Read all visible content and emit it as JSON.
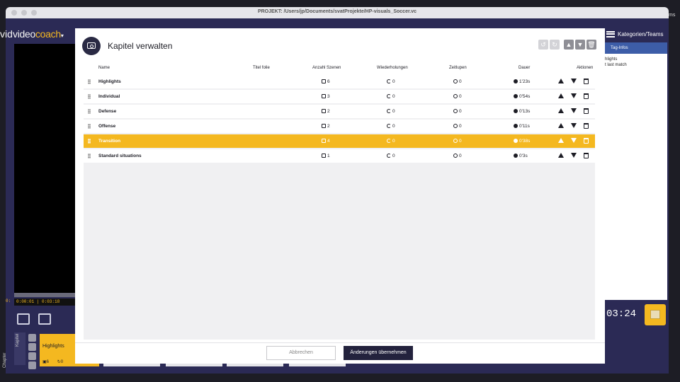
{
  "window": {
    "title": "PROJEKT: /Users/jp/Documents/svatProjekte/HP-visuals_Soccer.vc"
  },
  "app": {
    "logo_main": "video",
    "logo_accent": "coach",
    "logo_partial": "vid",
    "timecode": "0:00:01 | 0:03:18",
    "timecode_left": "0:",
    "big_time": "03:24",
    "top_edge_text": "ms",
    "sidebar_label": "Kapitel",
    "chapter_label": "Chapter",
    "chapter_card": {
      "title": "Highlights",
      "scenes": "6",
      "repeats": "0"
    },
    "right_header": "Kategorien/Teams",
    "tag_tab": "Tag-Infos",
    "tag_lines": [
      "hlights",
      "t last match"
    ]
  },
  "modal": {
    "title": "Kapitel verwalten",
    "columns": [
      "Name",
      "Titel folie",
      "Anzahl Szenen",
      "Wiederholungen",
      "Zeitlupen",
      "Dauer",
      "Aktionen"
    ],
    "rows": [
      {
        "name": "Highlights",
        "scenes": "6",
        "repeats": "0",
        "slowmo": "0",
        "duration": "1'23s",
        "selected": false
      },
      {
        "name": "Individual",
        "scenes": "3",
        "repeats": "0",
        "slowmo": "0",
        "duration": "0'54s",
        "selected": false
      },
      {
        "name": "Defense",
        "scenes": "2",
        "repeats": "0",
        "slowmo": "0",
        "duration": "0'13s",
        "selected": false
      },
      {
        "name": "Offense",
        "scenes": "2",
        "repeats": "0",
        "slowmo": "0",
        "duration": "0'11s",
        "selected": false
      },
      {
        "name": "Transition",
        "scenes": "4",
        "repeats": "0",
        "slowmo": "0",
        "duration": "0'38s",
        "selected": true
      },
      {
        "name": "Standard situations",
        "scenes": "1",
        "repeats": "0",
        "slowmo": "0",
        "duration": "0'3s",
        "selected": false
      }
    ],
    "cancel_label": "Abbrechen",
    "apply_label": "Änderungen übernehmen"
  },
  "colors": {
    "accent": "#f4b820",
    "dark": "#23223d",
    "app_bg": "#2b2a55"
  }
}
